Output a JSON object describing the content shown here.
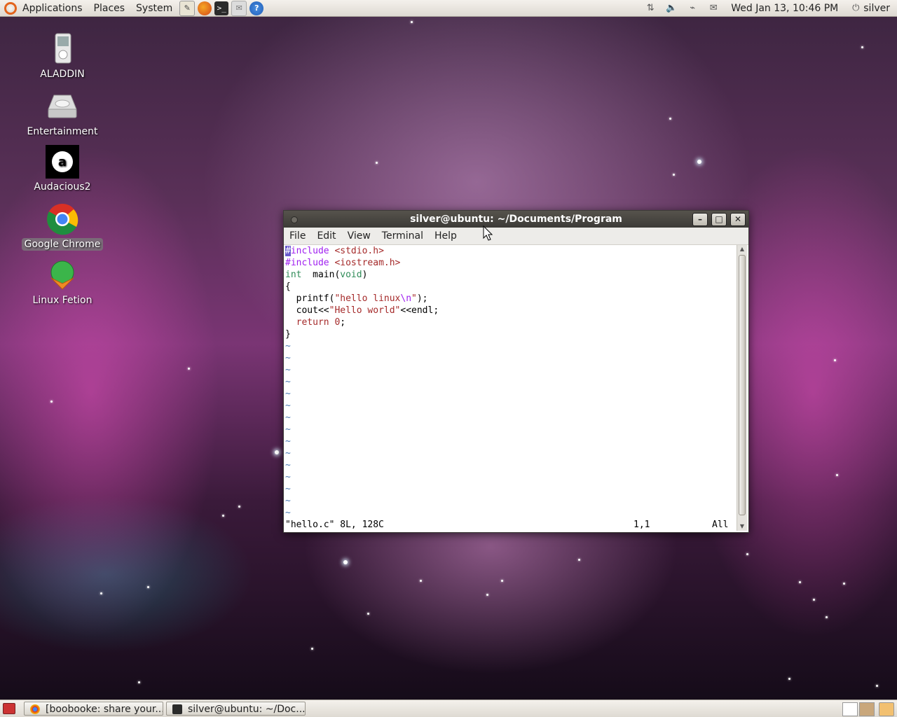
{
  "top_panel": {
    "menus": [
      "Applications",
      "Places",
      "System"
    ],
    "launchers": [
      "text-editor-icon",
      "firefox-icon",
      "terminal-icon",
      "email-icon",
      "help-icon"
    ],
    "clock": "Wed Jan 13, 10:46 PM",
    "user": "silver"
  },
  "desktop_icons": [
    {
      "label": "ALADDIN",
      "icon": "media-player-icon"
    },
    {
      "label": "Entertainment",
      "icon": "drive-icon"
    },
    {
      "label": "Audacious2",
      "icon": "audacious-icon"
    },
    {
      "label": "Google Chrome",
      "icon": "chrome-icon",
      "selected": true
    },
    {
      "label": "Linux Fetion",
      "icon": "fetion-icon"
    }
  ],
  "terminal": {
    "title": "silver@ubuntu: ~/Documents/Program",
    "menu": [
      "File",
      "Edit",
      "View",
      "Terminal",
      "Help"
    ],
    "status_file": "\"hello.c\" 8L, 128C",
    "status_pos": "1,1",
    "status_all": "All"
  },
  "taskbar": {
    "tasks": [
      "[boobooke: share your...",
      "silver@ubuntu: ~/Doc..."
    ]
  },
  "colors": {
    "ubuntu_orange": "#e3641d",
    "vim_preproc": "#a020f0",
    "vim_string": "#a52a2a",
    "vim_type": "#2e8b57",
    "vim_tilde": "#4a7ab4"
  }
}
